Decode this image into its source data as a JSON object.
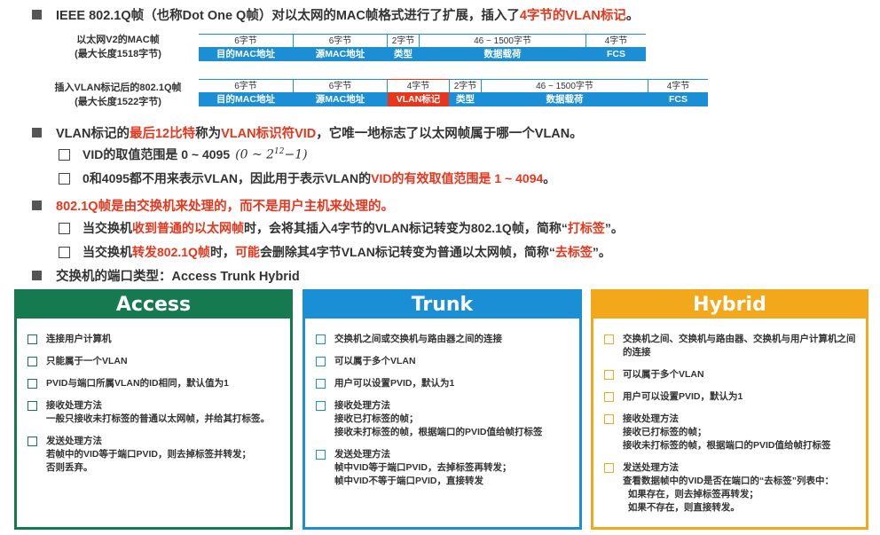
{
  "line1": {
    "prefix": "IEEE 802.1Q帧（也称Dot One Q帧）对以太网的MAC帧格式进行了扩展，插入了",
    "highlight": "4字节的VLAN标记",
    "suffix": "。"
  },
  "frame1": {
    "label1": "以太网V2的MAC帧",
    "label2": "(最大长度1518字节)",
    "cells": [
      {
        "size": "6字节",
        "name": "目的MAC地址"
      },
      {
        "size": "6字节",
        "name": "源MAC地址"
      },
      {
        "size": "2字节",
        "name": "类型"
      },
      {
        "size": "46 ~ 1500字节",
        "name": "数据载荷"
      },
      {
        "size": "4字节",
        "name": "FCS"
      }
    ]
  },
  "frame2": {
    "label1": "插入VLAN标记后的802.1Q帧",
    "label2": "(最大长度1522字节)",
    "cells": [
      {
        "size": "6字节",
        "name": "目的MAC地址"
      },
      {
        "size": "6字节",
        "name": "源MAC地址"
      },
      {
        "size": "4字节",
        "name": "VLAN标记"
      },
      {
        "size": "2字节",
        "name": "类型"
      },
      {
        "size": "46 ~ 1500字节",
        "name": "数据载荷"
      },
      {
        "size": "4字节",
        "name": "FCS"
      }
    ]
  },
  "line2": {
    "a": "VLAN标记的",
    "b": "最后12比特",
    "c": "称为",
    "d": "VLAN标识符VID",
    "e": "，它唯一地标志了以太网帧属于哪一个VLAN。"
  },
  "line2_sub1": {
    "text": "VID的取值范围是 0 ~ 4095",
    "formula_pre": "(0 ~ 2",
    "formula_sup": "12",
    "formula_post": "−1)"
  },
  "line2_sub2": {
    "a": "0和4095都不用来表示VLAN，因此用于表示VLAN的",
    "b": "VID的有效取值范围是 1 ~ 4094",
    "c": "。"
  },
  "line3": {
    "text": "802.1Q帧是由交换机来处理的，而不是用户主机来处理的。"
  },
  "line3_sub1": {
    "a": "当交换机",
    "b": "收到普通的以太网帧",
    "c": "时，会将其插入4字节的VLAN标记转变为802.1Q帧，简称“",
    "d": "打标签",
    "e": "”。"
  },
  "line3_sub2": {
    "a": "当交换机",
    "b": "转发802.1Q帧",
    "c": "时，",
    "d": "可能",
    "e": "会删除其4字节VLAN标记转变为普通以太网帧，简称“",
    "f": "去标签",
    "g": "”。"
  },
  "line4": {
    "text": "交换机的端口类型：Access  Trunk  Hybrid"
  },
  "colors": {
    "access": "#157a4f",
    "trunk": "#1b8fd6",
    "hybrid": "#f3a81b",
    "highlight": "#e8361c"
  },
  "access": {
    "title": "Access",
    "items": [
      {
        "label": "连接用户计算机",
        "desc": []
      },
      {
        "label": "只能属于一个VLAN",
        "desc": []
      },
      {
        "label": "PVID与端口所属VLAN的ID相同，默认值为1",
        "desc": []
      },
      {
        "label": "接收处理方法",
        "desc": [
          "一般只接收未打标签的普通以太网帧，并给其打标签。"
        ]
      },
      {
        "label": "发送处理方法",
        "desc": [
          "若帧中的VID等于端口PVID，则去掉标签并转发；",
          "否则丢弃。"
        ]
      }
    ]
  },
  "trunk": {
    "title": "Trunk",
    "items": [
      {
        "label": "交换机之间或交换机与路由器之间的连接",
        "desc": []
      },
      {
        "label": "可以属于多个VLAN",
        "desc": []
      },
      {
        "label": "用户可以设置PVID，默认为1",
        "desc": []
      },
      {
        "label": "接收处理方法",
        "desc": [
          "接收已打标签的帧；",
          "接收未打标签的帧，根据端口的PVID值给帧打标签"
        ]
      },
      {
        "label": "发送处理方法",
        "desc": [
          "帧中VID等于端口PVID，去掉标签再转发；",
          "帧中VID不等于端口PVID，直接转发"
        ]
      }
    ]
  },
  "hybrid": {
    "title": "Hybrid",
    "items": [
      {
        "label": "交换机之间、交换机与路由器、交换机与用户计算机之间的连接",
        "desc": []
      },
      {
        "label": "可以属于多个VLAN",
        "desc": []
      },
      {
        "label": "用户可以设置PVID，默认为1",
        "desc": []
      },
      {
        "label": "接收处理方法",
        "desc": [
          "接收已打标签的帧；",
          "接收未打标签的帧，根据端口的PVID值给帧打标签"
        ]
      },
      {
        "label": "发送处理方法",
        "desc": [
          "查看数据帧中的VID是否在端口的“去标签”列表中：",
          "  如果存在，则去掉标签再转发；",
          "  如果不存在，则直接转发。"
        ]
      }
    ]
  }
}
